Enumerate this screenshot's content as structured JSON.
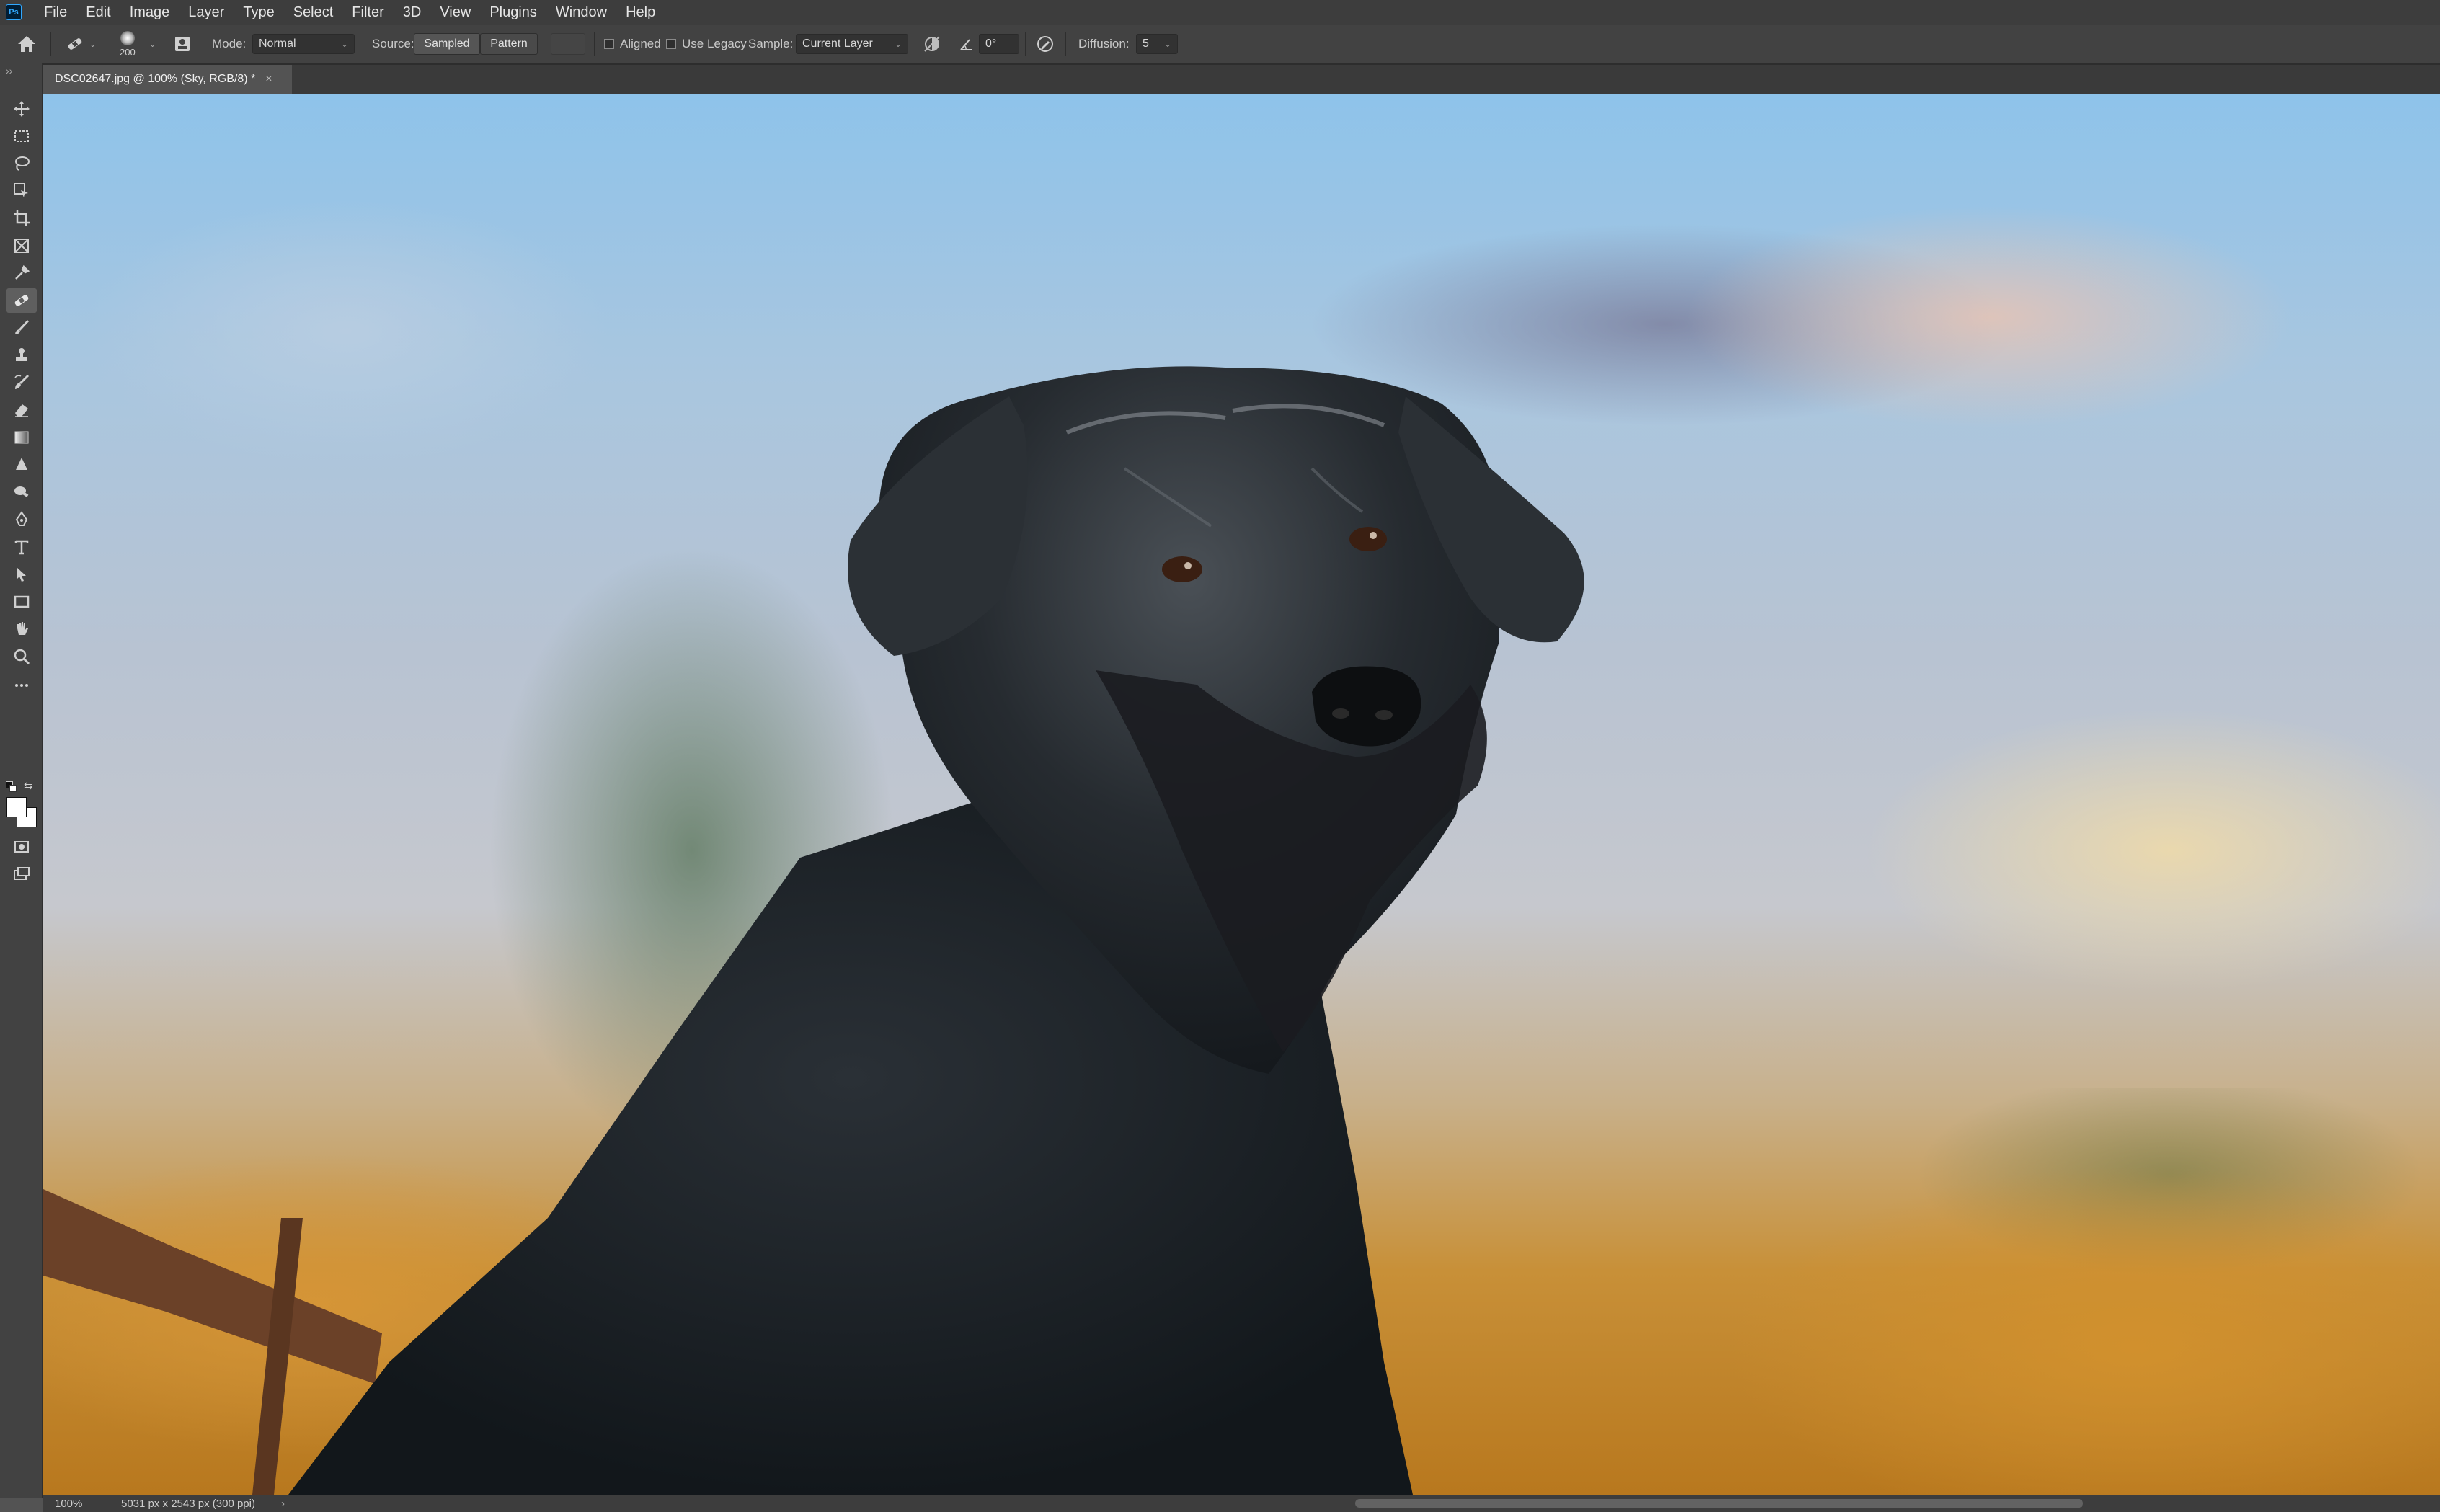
{
  "app": {
    "logo_text": "Ps"
  },
  "menu": [
    "File",
    "Edit",
    "Image",
    "Layer",
    "Type",
    "Select",
    "Filter",
    "3D",
    "View",
    "Plugins",
    "Window",
    "Help"
  ],
  "options": {
    "brush_size": "200",
    "mode_label": "Mode:",
    "mode_value": "Normal",
    "source_label": "Source:",
    "source_sampled": "Sampled",
    "source_pattern": "Pattern",
    "aligned_label": "Aligned",
    "use_legacy_label": "Use Legacy",
    "sample_label": "Sample:",
    "sample_value": "Current Layer",
    "angle_value": "0°",
    "diffusion_label": "Diffusion:",
    "diffusion_value": "5"
  },
  "document": {
    "tab_title": "DSC02647.jpg @ 100% (Sky, RGB/8) *",
    "close_glyph": "×"
  },
  "status": {
    "zoom": "100%",
    "doc_info": "5031 px x 2543 px (300 ppi)",
    "arrow": "›"
  },
  "colors": {
    "ui_dark": "#3d3d3d",
    "ui_panel": "#424242",
    "canvas_bg": "#535353",
    "ps_blue": "#31a8ff",
    "foreground_swatch": "#ffffff",
    "background_swatch": "#ffffff"
  },
  "toolbar_icons": [
    "move-icon",
    "marquee-icon",
    "lasso-icon",
    "object-selection-icon",
    "crop-icon",
    "frame-icon",
    "eyedropper-icon",
    "healing-brush-icon",
    "brush-icon",
    "clone-stamp-icon",
    "history-brush-icon",
    "eraser-icon",
    "gradient-icon",
    "blur-icon",
    "dodge-icon",
    "pen-icon",
    "type-icon",
    "path-selection-icon",
    "rectangle-icon",
    "hand-icon",
    "zoom-icon",
    "more-tools-icon"
  ]
}
